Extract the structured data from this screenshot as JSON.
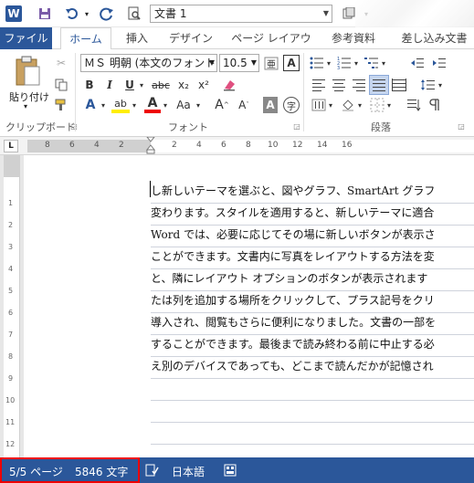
{
  "quick_access": {
    "app_icon": "W",
    "icons": [
      "save-icon",
      "undo-icon",
      "redo-icon",
      "print-preview-icon",
      "customize-icon"
    ]
  },
  "doc_combo": {
    "value": "文書 1"
  },
  "tabs": [
    "ファイル",
    "ホーム",
    "挿入",
    "デザイン",
    "ページ レイアウト",
    "参考資料",
    "差し込み文書"
  ],
  "ribbon": {
    "paste_label": "貼り付け",
    "font_name": "ＭＳ 明朝 (本文のフォント",
    "font_size": "10.5",
    "groups": [
      "クリップボード",
      "フォント",
      "段落"
    ],
    "buttons": {
      "bold": "B",
      "italic": "I",
      "underline": "U",
      "strike": "abc",
      "subscript": "x₂",
      "superscript": "x²",
      "font_size_up": "A",
      "font_size_down": "A",
      "change_case": "Aa",
      "clear_format": "A",
      "char_shading": "A",
      "enclose": "字",
      "text_effect": "A",
      "highlight": "ab",
      "font_color": "A",
      "ruby": "亜",
      "border_char": "A"
    }
  },
  "ruler": {
    "tab_selector": "L",
    "left_numbers": [
      "8",
      "6",
      "4",
      "2"
    ],
    "right_numbers": [
      "2",
      "4",
      "6",
      "8",
      "10",
      "12",
      "14",
      "16"
    ]
  },
  "vruler_numbers": [
    "1",
    "2",
    "3",
    "4",
    "5",
    "6",
    "7",
    "8",
    "9",
    "10",
    "11",
    "12"
  ],
  "document": {
    "lines": [
      "し新しいテーマを選ぶと、図やグラフ、SmartArt グラフ",
      "変わります。スタイルを適用すると、新しいテーマに適合",
      "Word では、必要に応じてその場に新しいボタンが表示さ",
      "ことができます。文書内に写真をレイアウトする方法を変",
      "と、隣にレイアウト オプションのボタンが表示されます",
      "たは列を追加する場所をクリックして、プラス記号をクリ",
      "導入され、閲覧もさらに便利になりました。文書の一部を",
      "することができます。最後まで読み終わる前に中止する必",
      "え別のデバイスであっても、どこまで読んだかが記憶され"
    ]
  },
  "status": {
    "page": "5/5 ページ",
    "words": "5846 文字",
    "language": "日本語"
  },
  "colors": {
    "accent": "#2b579a",
    "highlight_box": "#e00000"
  }
}
